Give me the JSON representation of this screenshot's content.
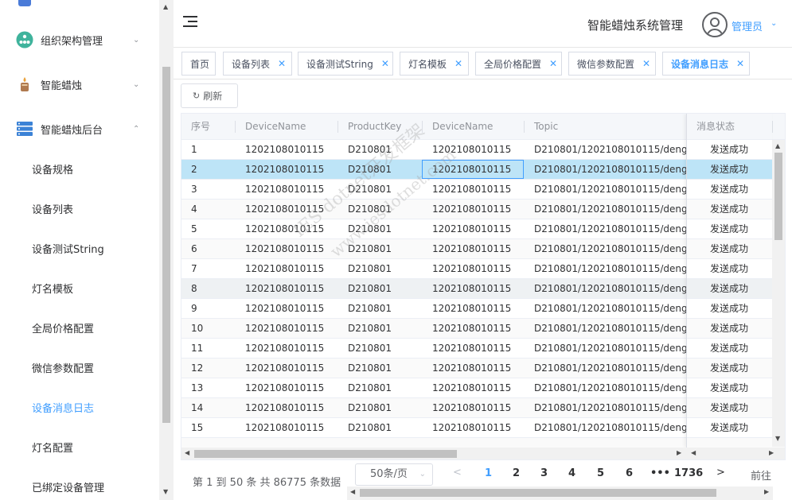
{
  "sidebar": {
    "groups": [
      {
        "label": "组织架构管理",
        "icon": "org-structure-icon"
      },
      {
        "label": "智能蜡烛",
        "icon": "candle-icon"
      },
      {
        "label": "智能蜡烛后台",
        "icon": "server-icon"
      }
    ],
    "submenu": [
      {
        "label": "设备规格"
      },
      {
        "label": "设备列表"
      },
      {
        "label": "设备测试String"
      },
      {
        "label": "灯名模板"
      },
      {
        "label": "全局价格配置"
      },
      {
        "label": "微信参数配置"
      },
      {
        "label": "设备消息日志"
      },
      {
        "label": "灯名配置"
      },
      {
        "label": "已绑定设备管理"
      }
    ],
    "active_item": "设备消息日志"
  },
  "header": {
    "system_title": "智能蜡烛系统管理",
    "user_name": "管理员"
  },
  "tags": [
    {
      "label": "首页",
      "closable": false
    },
    {
      "label": "设备列表",
      "closable": true
    },
    {
      "label": "设备测试String",
      "closable": true
    },
    {
      "label": "灯名模板",
      "closable": true
    },
    {
      "label": "全局价格配置",
      "closable": true
    },
    {
      "label": "微信参数配置",
      "closable": true
    },
    {
      "label": "设备消息日志",
      "closable": true,
      "active": true
    }
  ],
  "toolbar": {
    "refresh_label": "刷新"
  },
  "table": {
    "columns": [
      "序号",
      "DeviceName",
      "ProductKey",
      "DeviceName",
      "Topic",
      "消息状态"
    ],
    "rows": [
      [
        "1",
        "1202108010115",
        "D210801",
        "1202108010115",
        "D210801/1202108010115/deng",
        "发送成功"
      ],
      [
        "2",
        "1202108010115",
        "D210801",
        "1202108010115",
        "D210801/1202108010115/deng",
        "发送成功"
      ],
      [
        "3",
        "1202108010115",
        "D210801",
        "1202108010115",
        "D210801/1202108010115/deng",
        "发送成功"
      ],
      [
        "4",
        "1202108010115",
        "D210801",
        "1202108010115",
        "D210801/1202108010115/deng",
        "发送成功"
      ],
      [
        "5",
        "1202108010115",
        "D210801",
        "1202108010115",
        "D210801/1202108010115/deng",
        "发送成功"
      ],
      [
        "6",
        "1202108010115",
        "D210801",
        "1202108010115",
        "D210801/1202108010115/deng",
        "发送成功"
      ],
      [
        "7",
        "1202108010115",
        "D210801",
        "1202108010115",
        "D210801/1202108010115/deng",
        "发送成功"
      ],
      [
        "8",
        "1202108010115",
        "D210801",
        "1202108010115",
        "D210801/1202108010115/deng",
        "发送成功"
      ],
      [
        "9",
        "1202108010115",
        "D210801",
        "1202108010115",
        "D210801/1202108010115/deng",
        "发送成功"
      ],
      [
        "10",
        "1202108010115",
        "D210801",
        "1202108010115",
        "D210801/1202108010115/deng",
        "发送成功"
      ],
      [
        "11",
        "1202108010115",
        "D210801",
        "1202108010115",
        "D210801/1202108010115/deng",
        "发送成功"
      ],
      [
        "12",
        "1202108010115",
        "D210801",
        "1202108010115",
        "D210801/1202108010115/deng",
        "发送成功"
      ],
      [
        "13",
        "1202108010115",
        "D210801",
        "1202108010115",
        "D210801/1202108010115/deng",
        "发送成功"
      ],
      [
        "14",
        "1202108010115",
        "D210801",
        "1202108010115",
        "D210801/1202108010115/deng",
        "发送成功"
      ],
      [
        "15",
        "1202108010115",
        "D210801",
        "1202108010115",
        "D210801/1202108010115/deng",
        "发送成功"
      ]
    ],
    "selected_row": 2,
    "hover_row": 8
  },
  "watermark": [
    "IES dotnet开发框架",
    "www.iesdotnet.com"
  ],
  "pagination": {
    "total_text": "第 1 到 50 条 共 86775 条数据",
    "page_size": "50条/页",
    "pages": [
      "1",
      "2",
      "3",
      "4",
      "5",
      "6",
      "•••",
      "1736"
    ],
    "current_page": "1",
    "goto_label": "前往"
  },
  "colors": {
    "accent": "#409eff",
    "selected_row": "#bde4f7"
  }
}
